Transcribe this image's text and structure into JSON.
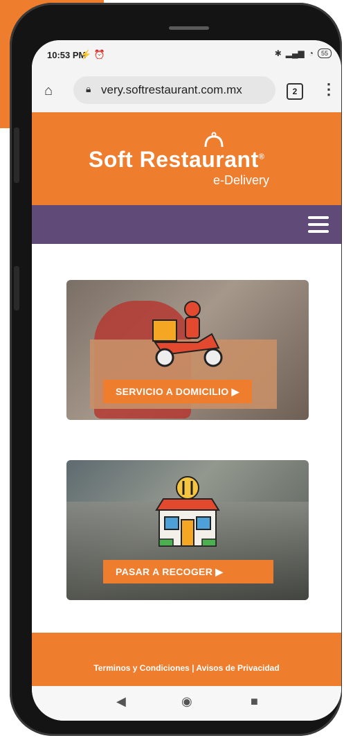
{
  "status_bar": {
    "time": "10:53 PM",
    "notif_icons": "⚡ ⏰",
    "battery": "55"
  },
  "browser": {
    "url": "very.softrestaurant.com.mx",
    "tab_count": "2"
  },
  "brand": {
    "name": "Soft Restaurant",
    "reg_mark": "®",
    "tagline": "e-Delivery"
  },
  "cards": [
    {
      "label": "SERVICIO A DOMICILIO ▶"
    },
    {
      "label": "PASAR A RECOGER ▶"
    }
  ],
  "footer": {
    "terms": "Terminos y Condiciones",
    "separator": "|",
    "privacy": "Avisos de Privacidad"
  },
  "colors": {
    "accent": "#ee7d2e",
    "nav": "#5f4a78"
  },
  "icons": [
    "home-icon",
    "lock-icon",
    "tabs-icon",
    "menu-dots-icon",
    "hamburger-icon",
    "delivery-scooter-icon",
    "store-icon",
    "back-icon",
    "home-circle-icon",
    "recents-icon"
  ]
}
